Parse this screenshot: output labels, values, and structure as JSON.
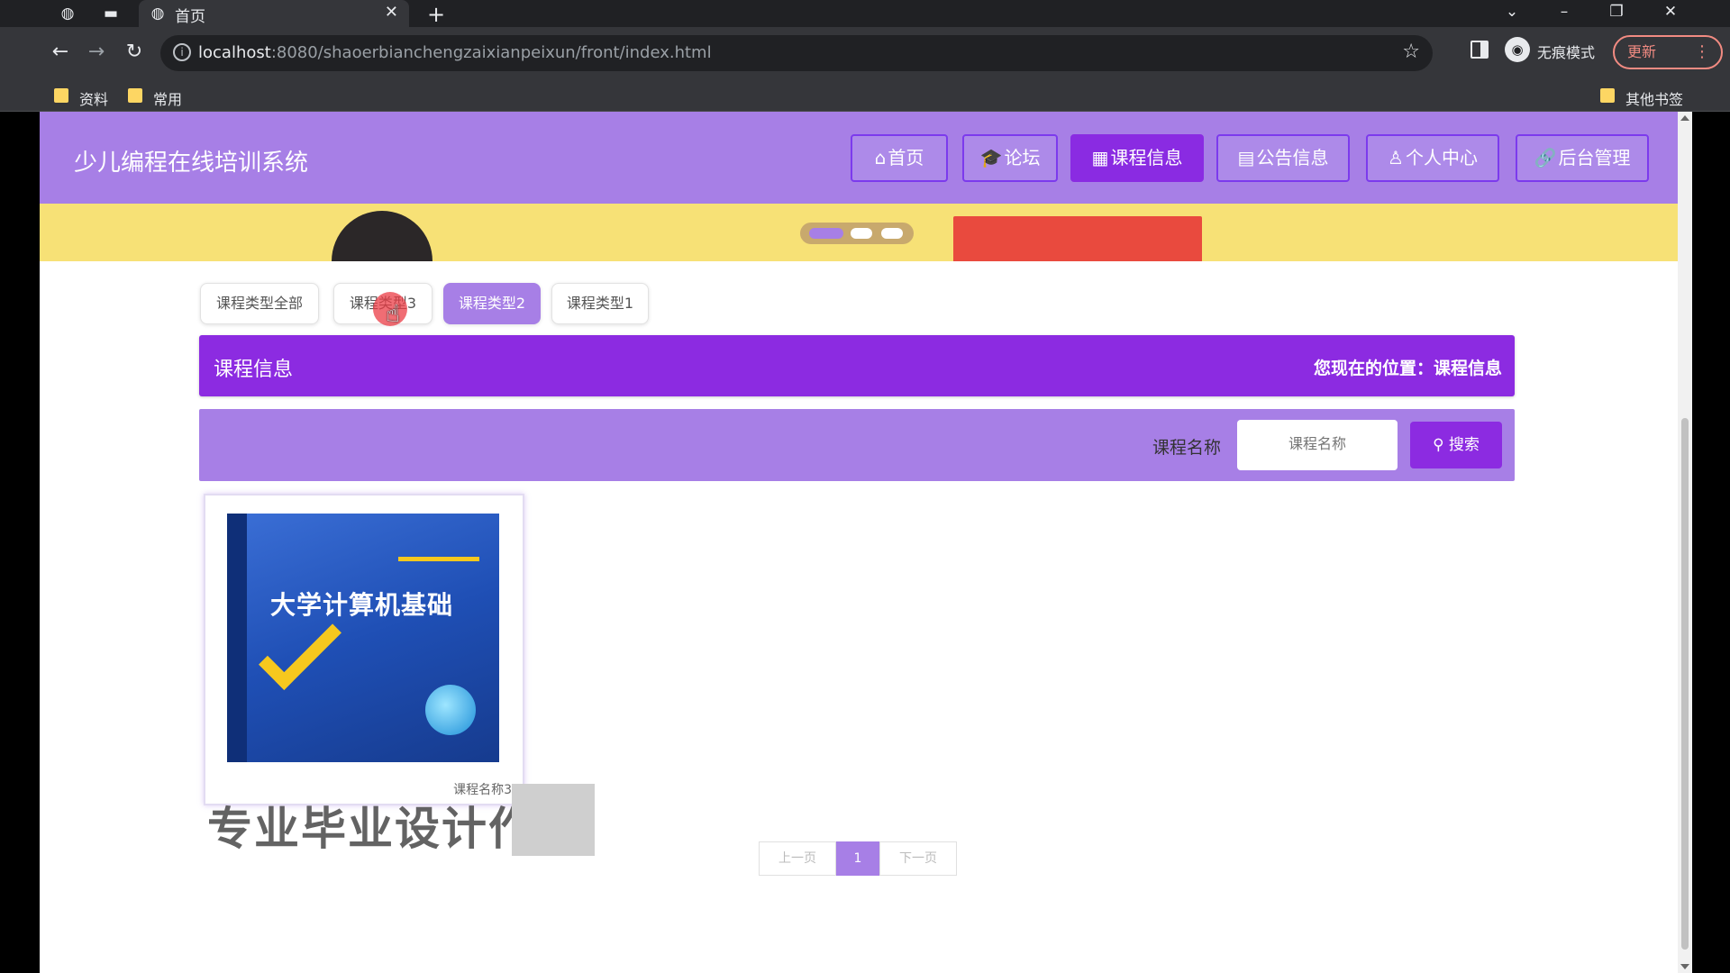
{
  "browser": {
    "tab_title": "首页",
    "url_host": "localhost",
    "url_rest": ":8080/shaoerbianchengzaixianpeixun/front/index.html",
    "incognito_label": "无痕模式",
    "update_label": "更新",
    "bookmarks": [
      "资料",
      "常用"
    ],
    "other_bookmarks": "其他书签"
  },
  "site": {
    "title": "少儿编程在线培训系统",
    "nav": [
      {
        "icon": "⌂",
        "label": "首页"
      },
      {
        "icon": "🎓",
        "label": "论坛"
      },
      {
        "icon": "▦",
        "label": "课程信息"
      },
      {
        "icon": "▤",
        "label": "公告信息"
      },
      {
        "icon": "♙",
        "label": "个人中心"
      },
      {
        "icon": "🔗",
        "label": "后台管理"
      }
    ],
    "active_nav": "课程信息"
  },
  "categories": {
    "items": [
      "课程类型全部",
      "课程类型3",
      "课程类型2",
      "课程类型1"
    ],
    "active": "课程类型2"
  },
  "section": {
    "title": "课程信息",
    "breadcrumb": "您现在的位置：课程信息"
  },
  "search": {
    "label": "课程名称",
    "placeholder": "课程名称",
    "button_label": "搜索"
  },
  "courses": [
    {
      "name": "课程名称3",
      "cover_title": "大学计算机基础"
    }
  ],
  "watermark": "专业毕业设计作",
  "pager": {
    "prev": "上一页",
    "current": "1",
    "next": "下一页"
  },
  "colors": {
    "header": "#a77fe6",
    "primary": "#8c2be1",
    "banner": "#f7e176"
  }
}
